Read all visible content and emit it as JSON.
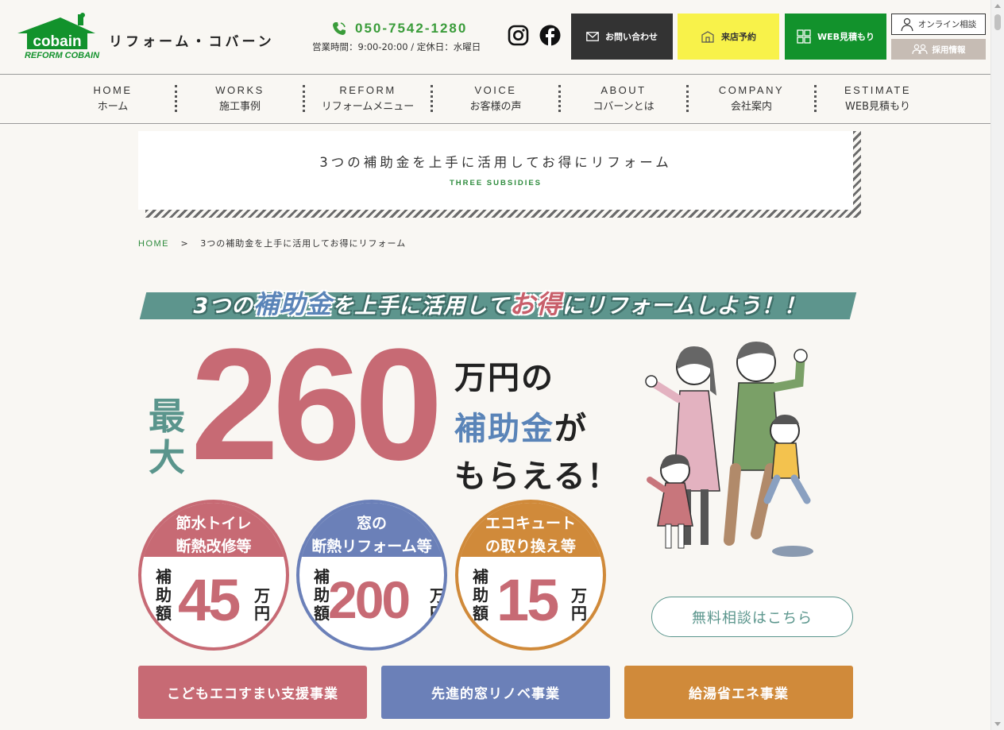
{
  "header": {
    "site_name": "リフォーム・コバーン",
    "logo_text_top": "cobain",
    "logo_text_bottom": "REFORM COBAIN",
    "phone": "050-7542-1280",
    "hours": "営業時間：9:00-20:00 / 定休日：水曜日",
    "buttons": {
      "contact": "お問い合わせ",
      "visit": "来店予約",
      "web_estimate": "WEB見積もり",
      "online": "オンライン相談",
      "recruit": "採用情報"
    },
    "colors": {
      "brand_green": "#12922c",
      "yellow": "#f8f24a",
      "dark": "#333333"
    }
  },
  "nav": [
    {
      "en": "HOME",
      "ja": "ホーム"
    },
    {
      "en": "WORKS",
      "ja": "施工事例"
    },
    {
      "en": "REFORM",
      "ja": "リフォームメニュー"
    },
    {
      "en": "VOICE",
      "ja": "お客様の声"
    },
    {
      "en": "ABOUT",
      "ja": "コバーンとは"
    },
    {
      "en": "COMPANY",
      "ja": "会社案内"
    },
    {
      "en": "ESTIMATE",
      "ja": "WEB見積もり"
    }
  ],
  "page_title": {
    "ja": "3つの補助金を上手に活用してお得にリフォーム",
    "en": "THREE SUBSIDIES"
  },
  "breadcrumb": {
    "home": "HOME",
    "separator": ">",
    "current": "3つの補助金を上手に活用してお得にリフォーム"
  },
  "banner": {
    "ribbon": {
      "part1": "3つの",
      "highlight1": "補助金",
      "part2": "を上手に活用して",
      "highlight2": "お得",
      "part3": "にリフォームしよう！！"
    },
    "max_label": "最大",
    "big_number": "260",
    "line1": "万円の",
    "line2_blue": "補助金",
    "line2_rest": "が",
    "line3": "もらえる！",
    "circles": [
      {
        "head": "節水トイレ\n断熱改修等",
        "head_line1": "節水トイレ",
        "head_line2": "断熱改修等",
        "label": "補助額",
        "amount": "45",
        "unit": "万円",
        "color": "#c76a74"
      },
      {
        "head_line1": "窓の",
        "head_line2": "断熱リフォーム等",
        "label": "補助額",
        "amount": "200",
        "unit": "万円",
        "color": "#6b80b8"
      },
      {
        "head_line1": "エコキュート",
        "head_line2": "の取り換え等",
        "label": "補助額",
        "amount": "15",
        "unit": "万円",
        "color": "#d08a3a"
      }
    ],
    "consult_button": "無料相談はこちら"
  },
  "programs": [
    {
      "label": "こどもエコすまい支援事業",
      "color": "#c76a74"
    },
    {
      "label": "先進的窓リノベ事業",
      "color": "#6b80b8"
    },
    {
      "label": "給湯省エネ事業",
      "color": "#d08a3a"
    }
  ]
}
